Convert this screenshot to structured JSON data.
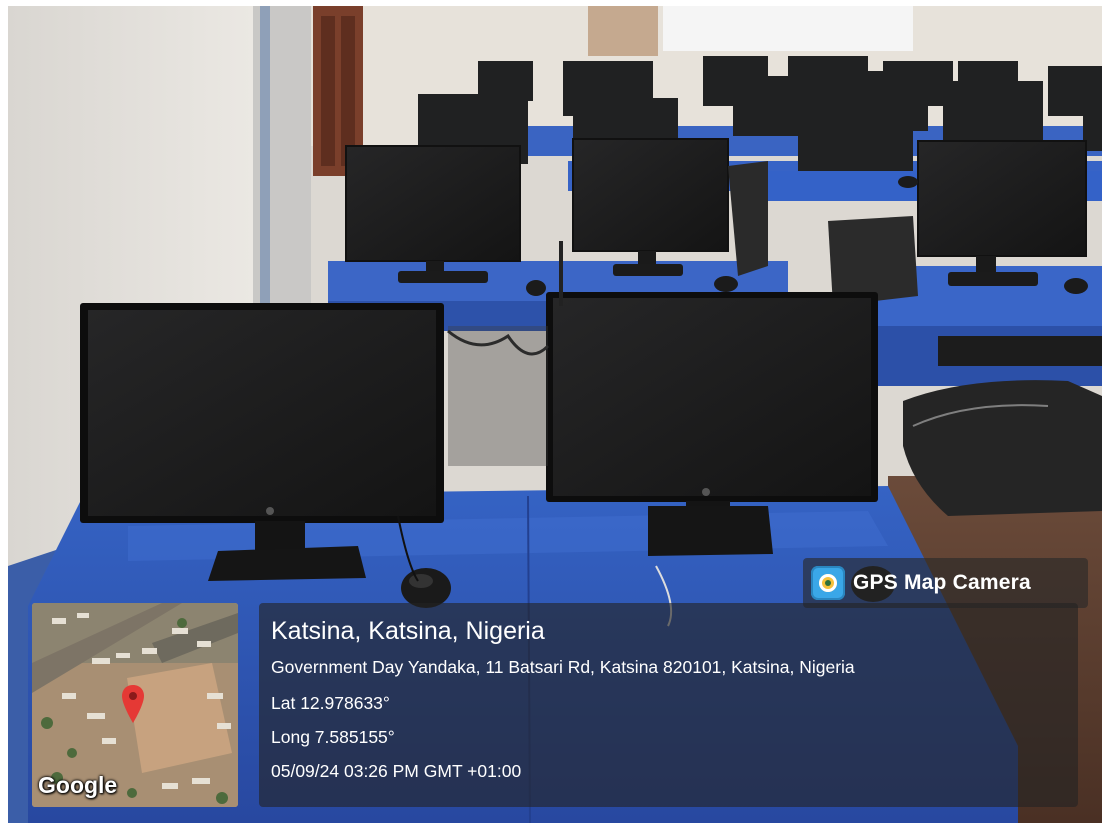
{
  "overlay": {
    "app_badge": "GPS Map Camera",
    "app_icon": "camera-lens-icon",
    "map_watermark": "Google",
    "location_title": "Katsina, Katsina, Nigeria",
    "address": "Government Day Yandaka, 11 Batsari Rd, Katsina 820101, Katsina, Nigeria",
    "latitude": "Lat 12.978633°",
    "longitude": "Long 7.585155°",
    "timestamp": "05/09/24 03:26 PM GMT +01:00"
  },
  "colors": {
    "desk_blue": "#2f57b8",
    "wall": "#e9e6e2",
    "monitor": "#1b1b1c",
    "overlay_bg": "#232323",
    "map_pin": "#e53935"
  }
}
